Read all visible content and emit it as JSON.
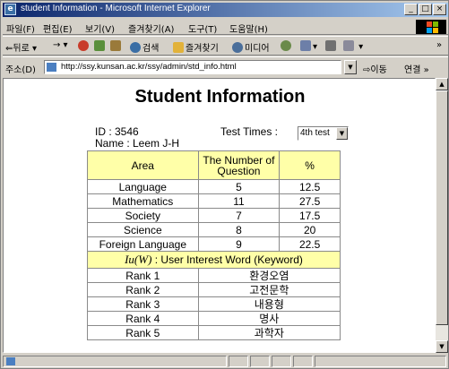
{
  "window": {
    "title": "student Information - Microsoft Internet Explorer",
    "buttons": [
      "_",
      "□",
      "×"
    ]
  },
  "menu": [
    "파일(F)",
    "편집(E)",
    "보기(V)",
    "즐겨찾기(A)",
    "도구(T)",
    "도움말(H)"
  ],
  "toolbar": {
    "back": "뒤로",
    "search": "검색",
    "favorites": "즐겨찾기",
    "media": "미디어"
  },
  "address": {
    "label": "주소(D)",
    "url": "http://ssy.kunsan.ac.kr/ssy/admin/std_info.html",
    "go": "이동",
    "links": "연결"
  },
  "page": {
    "title": "Student Information",
    "id_line": "ID : 3546",
    "name_line": "Name : Leem J-H",
    "test_times_label": "Test Times :",
    "test_times_value": "4th test"
  },
  "table": {
    "headers": [
      "Area",
      "The Number of Question",
      "%"
    ],
    "rows": [
      [
        "Language",
        "5",
        "12.5"
      ],
      [
        "Mathematics",
        "11",
        "27.5"
      ],
      [
        "Society",
        "7",
        "17.5"
      ],
      [
        "Science",
        "8",
        "20"
      ],
      [
        "Foreign Language",
        "9",
        "22.5"
      ]
    ],
    "interest_header_symbol": "Iu(W)",
    "interest_header_text": " : User Interest Word (Keyword)",
    "ranks": [
      [
        "Rank 1",
        "환경오염"
      ],
      [
        "Rank 2",
        "고전문학"
      ],
      [
        "Rank 3",
        "내용형"
      ],
      [
        "Rank 4",
        "명사"
      ],
      [
        "Rank 5",
        "과학자"
      ]
    ]
  }
}
